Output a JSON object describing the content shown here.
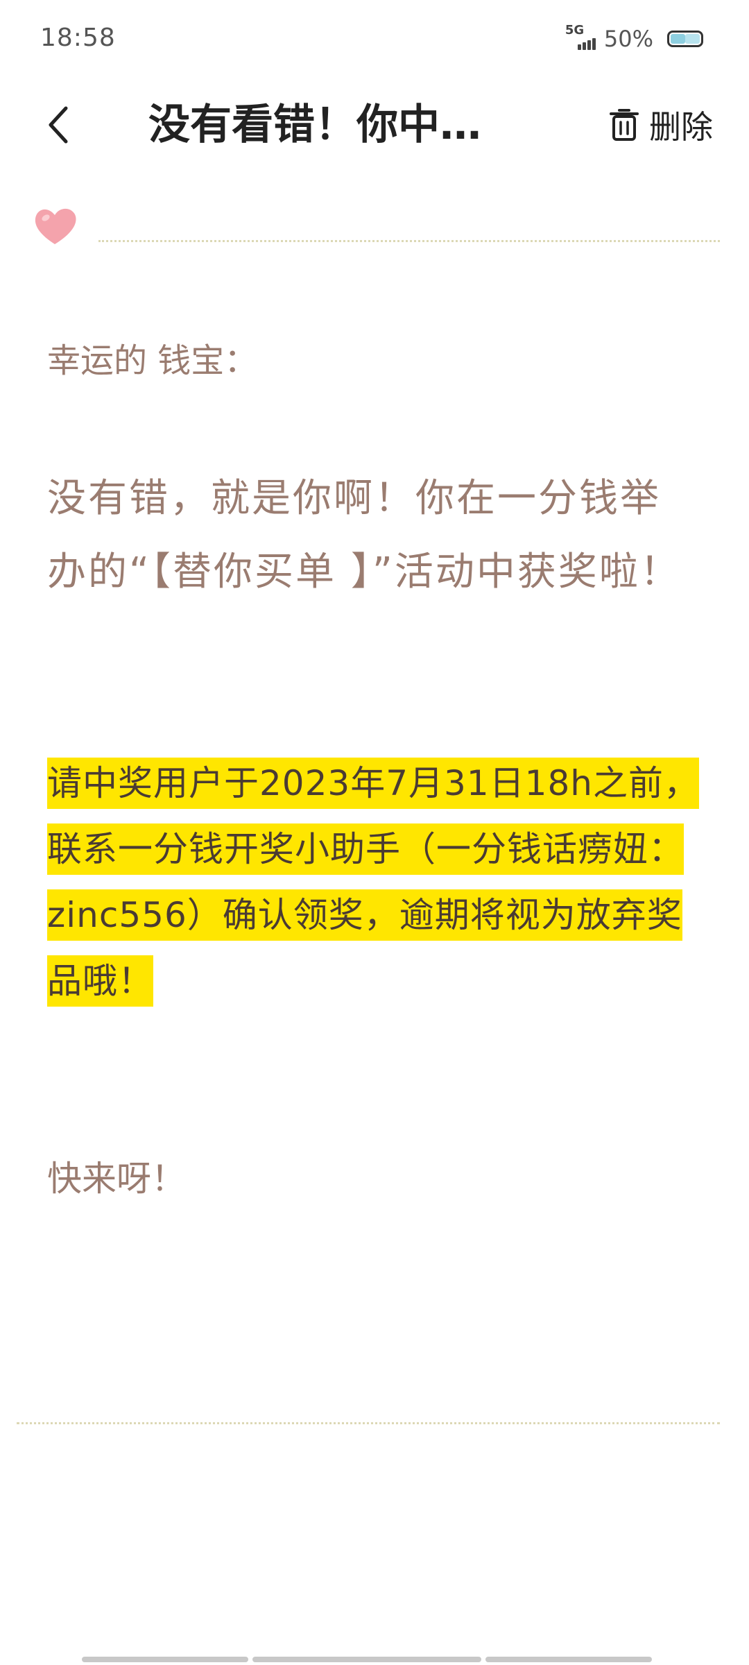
{
  "status_bar": {
    "time": "18:58",
    "network": "5G",
    "battery_percent": "50%",
    "battery_level": 0.5,
    "battery_color": "#8ecfe0"
  },
  "header": {
    "title": "没有看错！你中…",
    "back_icon": "chevron-left-icon",
    "delete_icon": "trash-icon",
    "delete_label": "删除"
  },
  "decoration": {
    "heart_icon": "heart-icon",
    "heart_color": "#f4a3ac",
    "divider_color": "#dcd8b5"
  },
  "body": {
    "greeting": "幸运的 钱宝：",
    "main_paragraph": "没有错，就是你啊！你在一分钱举办的“【替你买单 】”活动中获奖啦！",
    "highlight_paragraph": "请中奖用户于2023年7月31日18h之前，联系一分钱开奖小助手（一分钱话痨妞：zinc556）确认领奖，逾期将视为放弃奖品哦！",
    "highlight_color": "#ffe600",
    "closing": "快来呀！",
    "text_color": "#9a7c70"
  }
}
